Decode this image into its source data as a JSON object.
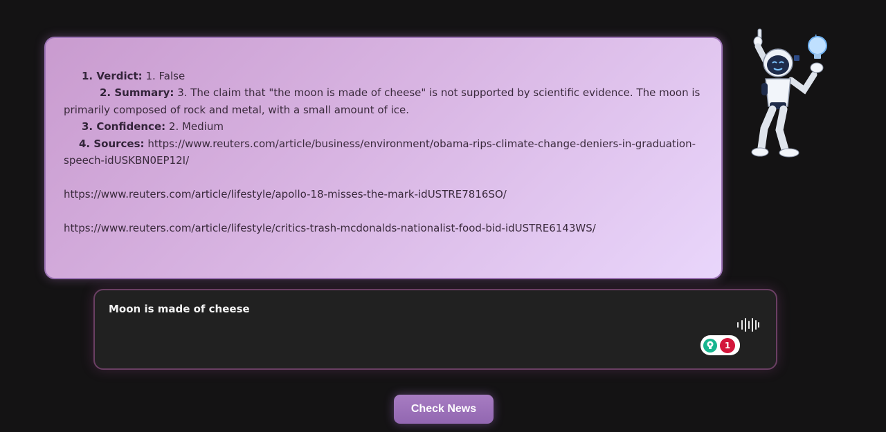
{
  "result": {
    "verdict_label": "1. Verdict:",
    "verdict_value": "1. False",
    "summary_label": "2. Summary:",
    "summary_value": "3. The claim that \"the moon is made of cheese\" is not supported by scientific evidence. The moon is primarily composed of rock and metal, with a small amount of ice.",
    "confidence_label": "3. Confidence:",
    "confidence_value": "2. Medium",
    "sources_label": "4. Sources:",
    "sources": [
      "https://www.reuters.com/article/business/environment/obama-rips-climate-change-deniers-in-graduation-speech-idUSKBN0EP12I/",
      "https://www.reuters.com/article/lifestyle/apollo-18-misses-the-mark-idUSTRE7816SO/",
      "https://www.reuters.com/article/lifestyle/critics-trash-mcdonalds-nationalist-food-bid-idUSTRE6143WS/"
    ]
  },
  "input": {
    "value": "Moon is made of cheese",
    "extension_badge_count": "1"
  },
  "check_button_label": "Check News",
  "icons": {
    "robot": "robot-illustration-icon",
    "mic": "voice-input-icon",
    "extension": "lightbulb-extension-icon"
  },
  "colors": {
    "background": "#141314",
    "card_gradient_start": "#c99bcf",
    "card_gradient_end": "#e9d6fb",
    "card_border": "#9d74b6",
    "input_background": "#212121",
    "input_border": "#6a3f63",
    "button": "#9d72ba",
    "badge_green": "#17b58f",
    "badge_red": "#d3163b"
  }
}
